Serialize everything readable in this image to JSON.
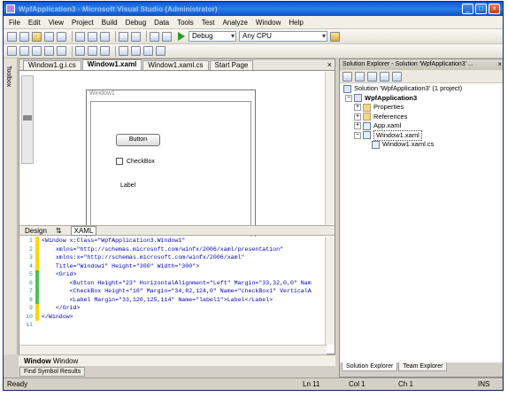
{
  "window": {
    "title": "WpfApplication3 - Microsoft Visual Studio (Administrator)"
  },
  "menu": [
    "File",
    "Edit",
    "View",
    "Project",
    "Build",
    "Debug",
    "Data",
    "Tools",
    "Test",
    "Analyze",
    "Window",
    "Help"
  ],
  "toolbar": {
    "configuration": "Debug",
    "platform": "Any CPU"
  },
  "toolbox_label": "Toolbox",
  "tabs": [
    {
      "label": "Window1.g.i.cs"
    },
    {
      "label": "Window1.xaml"
    },
    {
      "label": "Window1.xaml.cs"
    },
    {
      "label": "Start Page"
    }
  ],
  "designer": {
    "window_label": "Window1",
    "button_text": "Button",
    "checkbox_text": "CheckBox",
    "label_text": "Label"
  },
  "split": {
    "design": "Design",
    "swap": "⇅",
    "xaml": "XAML"
  },
  "code_lines": [
    {
      "num": "1",
      "text": "<Window x:Class=\"WpfApplication3.Window1\""
    },
    {
      "num": "2",
      "text": "    xmlns=\"http://schemas.microsoft.com/winfx/2006/xaml/presentation\""
    },
    {
      "num": "3",
      "text": "    xmlns:x=\"http://schemas.microsoft.com/winfx/2006/xaml\""
    },
    {
      "num": "4",
      "text": "    Title=\"Window1\" Height=\"300\" Width=\"300\">"
    },
    {
      "num": "5",
      "text": "    <Grid>"
    },
    {
      "num": "6",
      "text": "        <Button Height=\"23\" HorizontalAlignment=\"Left\" Margin=\"33,32,0,0\" Nam"
    },
    {
      "num": "7",
      "text": "        <CheckBox Height=\"16\" Margin=\"34,82,124,0\" Name=\"checkBox1\" VerticalA"
    },
    {
      "num": "8",
      "text": "        <Label Margin=\"33,120,125,114\" Name=\"label1\">Label</Label>"
    },
    {
      "num": "9",
      "text": "    </Grid>"
    },
    {
      "num": "10",
      "text": "</Window>"
    },
    {
      "num": "11",
      "text": ""
    }
  ],
  "breadcrumb": {
    "bold": "Window",
    "rest": "Window"
  },
  "bottom_tab": "Find Symbol Results",
  "solution_explorer": {
    "title": "Solution Explorer - Solution 'WpfApplication3' ...",
    "items": [
      {
        "label": "Solution 'WpfApplication3' (1 project)",
        "indent": 0
      },
      {
        "label": "WpfApplication3",
        "indent": 1,
        "bold": true
      },
      {
        "label": "Properties",
        "indent": 2
      },
      {
        "label": "References",
        "indent": 2
      },
      {
        "label": "App.xaml",
        "indent": 2
      },
      {
        "label": "Window1.xaml",
        "indent": 2,
        "selected": true
      },
      {
        "label": "Window1.xaml.cs",
        "indent": 3
      }
    ],
    "tabs": [
      "Solution Explorer",
      "Team Explorer"
    ]
  },
  "status": {
    "ready": "Ready",
    "ln": "Ln 11",
    "col": "Col 1",
    "ch": "Ch 1",
    "ins": "INS"
  }
}
